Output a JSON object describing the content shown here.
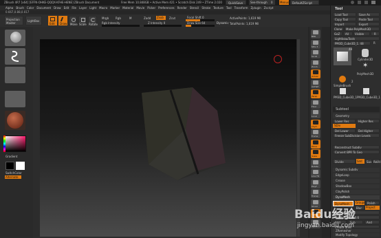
{
  "title_bar": {
    "title": "ZBrush 4R7 [x64] [EFFN-OHKE-QQQX-KFHE-HENE] ZBrush Document",
    "mem": "Free Mem 10.848GB • Active Mem 421 • Scratch Disk 249 • ZTime 2.020",
    "quicksave": "QuickSave",
    "seethrough": "See-through",
    "seethrough_value": "0",
    "menus_label": "Menus",
    "script_label": "DefaultZScript"
  },
  "menu_bar": [
    "Alpha",
    "Brush",
    "Color",
    "Document",
    "Draw",
    "Edit",
    "File",
    "Layer",
    "Light",
    "Macro",
    "Marker",
    "Material",
    "Movie",
    "Picker",
    "Preferences",
    "Render",
    "Stencil",
    "Stroke",
    "Texture",
    "Tool",
    "Transform",
    "Zplugin",
    "Zscript"
  ],
  "status_coords": "0.667,0.88,0.017",
  "toolbar": {
    "projection_master": "Projection Master",
    "lightbox": "LightBox",
    "edit": "Edit",
    "draw": "Draw",
    "move": "Move",
    "scale": "Scale",
    "rotate": "Rotate",
    "mrgb": "Mrgb",
    "rgb": "Rgb",
    "m": "M",
    "zadd": "Zadd",
    "zsub": "Zsub",
    "zcut": "Zcut",
    "rgb_intensity": "Rgb Intensity",
    "z_intensity": "Z Intensity 0",
    "focal_shift": "Focal Shift 0",
    "draw_size": "Draw Size 64",
    "dynamic": "Dynamic",
    "active_points": "ActivePoints: 1,619 Mil",
    "total_points": "TotalPoints: 1,619 Mil"
  },
  "left_panel": {
    "gradient": "Gradient",
    "switch_color": "SwitchColor",
    "alternate": "Alternate"
  },
  "right_icons": [
    "BPR",
    "SPix 3",
    "Scroll",
    "Zoom",
    "Actual",
    "AAHalf",
    "Persp",
    "Floor",
    "Local",
    "LSym",
    "Frame",
    "Move",
    "Scale",
    "Rotate",
    "Line Fill",
    "PolyF",
    "Transp",
    "Ghost",
    "Solo",
    "Xpose"
  ],
  "tool_panel": {
    "header": "Tool",
    "load_tool": "Load Tool",
    "save_as": "Save As",
    "copy_tool": "Copy Tool",
    "paste_tool": "Paste Tool",
    "import": "Import",
    "export": "Export",
    "clone": "Clone",
    "make_polymesh": "Make PolyMesh3D",
    "goz": "GoZ",
    "all": "All",
    "visible": "Visible",
    "r": "R",
    "lightbox_tools": "Lightbox▸Tools",
    "current_tool": "PM3D_Cube3D_1. 48",
    "r_label": "R",
    "thumbs": [
      "PM3D_Cube3D_1",
      "Cylinder3D",
      "PolyMesh3D",
      "SimpleBrush",
      "PM3D_Cube3D_1",
      "PM3D_Cube3D_1"
    ],
    "thumb_counts": [
      "2",
      "48"
    ],
    "subtool": "Subtool",
    "geometry": "Geometry",
    "lower_res": "Lower Res",
    "higher_res": "Higher Res",
    "sdiv": "SDiv",
    "del_lower": "Del Lower",
    "del_higher": "Del Higher",
    "freeze": "Freeze SubDivision Levels",
    "reconstruct": "Reconstruct Subdiv",
    "convert_bpr": "Convert BPR To Geo",
    "divide": "Divide",
    "smt": "Smt",
    "suv": "Suv",
    "rsuv": "ReUV",
    "dynamic_subdiv": "Dynamic Subdiv",
    "edgeloop": "EdgeLoop",
    "crease": "Crease",
    "shadowbox": "ShadowBox",
    "claypolish": "ClayPolish",
    "dynamesh": "DynaMesh",
    "dynamesh_btn": "DynaMesh",
    "groups": "Groups",
    "polish": "Polish",
    "blur": "Blur",
    "project": "Project",
    "resolution": "Resolution 128",
    "subproject": "SubProjection 0.6",
    "add": "Add",
    "sub": "Sub",
    "and": "And",
    "create_shell": "Create Shell",
    "thickness": "Thickness 4",
    "zremesher": "ZRemesher",
    "modify_topology": "Modify Topology",
    "position": "Position"
  },
  "watermark": {
    "text": "Baidu经验",
    "url": "jingyan.baidu.com"
  }
}
